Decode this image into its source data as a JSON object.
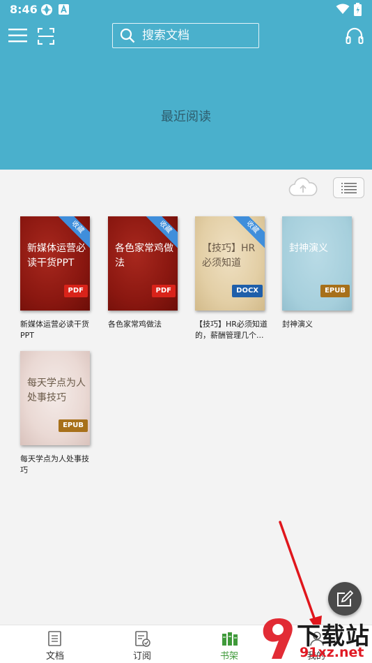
{
  "status_bar": {
    "time": "8:46"
  },
  "header": {
    "search_placeholder": "搜索文档",
    "recent_title": "最近阅读"
  },
  "books": [
    {
      "cover_title": "新媒体运营必读干货PPT",
      "name": "新媒体运营必读干货PPT",
      "format": "PDF",
      "ribbon": "收藏",
      "style": "red"
    },
    {
      "cover_title": "各色家常鸡做法",
      "name": "各色家常鸡做法",
      "format": "PDF",
      "ribbon": "收藏",
      "style": "red"
    },
    {
      "cover_title": "【技巧】HR必须知道",
      "name": "【技巧】HR必须知道的，薪酬管理几个...",
      "format": "DOCX",
      "ribbon": "收藏",
      "style": "beige"
    },
    {
      "cover_title": "封神演义",
      "name": "封神演义",
      "format": "EPUB",
      "ribbon": "",
      "style": "blue"
    },
    {
      "cover_title": "每天学点为人处事技巧",
      "name": "每天学点为人处事技巧",
      "format": "EPUB",
      "ribbon": "",
      "style": "pink"
    }
  ],
  "bottom_nav": [
    {
      "label": "文档",
      "icon": "document-icon"
    },
    {
      "label": "订阅",
      "icon": "subscribe-icon"
    },
    {
      "label": "书架",
      "icon": "bookshelf-icon",
      "active": true
    },
    {
      "label": "我的",
      "icon": "profile-icon"
    }
  ],
  "watermark": {
    "text": "下载站",
    "url": "91xz.net"
  },
  "colors": {
    "header": "#4ab0cc",
    "accent_green": "#3f9a3a",
    "pdf": "#d9231a",
    "docx": "#1f5faa",
    "epub": "#a7701a",
    "ribbon": "#3f8edb"
  }
}
